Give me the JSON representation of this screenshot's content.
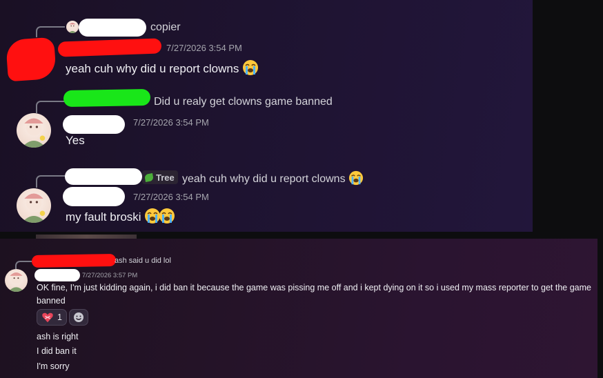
{
  "top": {
    "m1": {
      "reply_name": "copier",
      "timestamp": "7/27/2026 3:54 PM",
      "text": "yeah cuh why did u report clowns",
      "emoji": "loudly-crying-face"
    },
    "m2": {
      "reply_text": "Did u realy get clowns game banned",
      "timestamp": "7/27/2026 3:54 PM",
      "text": "Yes"
    },
    "m3": {
      "reply_tag": "Tree",
      "reply_text": "yeah cuh why did u report clowns",
      "reply_emoji": "loudly-crying-face",
      "timestamp": "7/27/2026 3:54 PM",
      "text": "my fault broski",
      "emoji": "loudly-crying-face x2"
    }
  },
  "bottom": {
    "reply_text": "ash said u did lol",
    "timestamp": "7/27/2026 3:57 PM",
    "text": "OK fine, I'm just kidding again, i did ban it because the game was pissing me off and i kept dying on it so i used my mass reporter to get the game banned",
    "reaction": {
      "emoji": "heart-with-ribbon",
      "count": "1"
    },
    "add_reaction_icon": "smiley-icon",
    "followups": [
      "ash is right",
      "I did ban it",
      "I'm sorry"
    ]
  },
  "colors": {
    "redaction_red": "#ff1010",
    "redaction_green": "#19e619",
    "redaction_white": "#ffffff",
    "text": "#f0f0f4",
    "timestamp": "#a5a5ad"
  }
}
